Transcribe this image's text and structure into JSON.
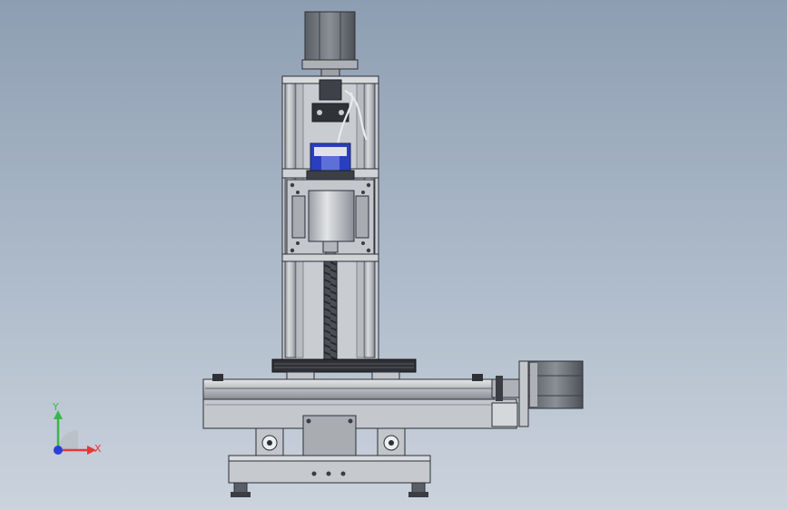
{
  "view": {
    "triad": {
      "x_label": "X",
      "y_label": "Y",
      "x_color": "#e8353a",
      "y_color": "#37b84a",
      "z_color": "#2b3fd8"
    },
    "colors": {
      "background_top": "#8e9eb2",
      "background_bottom": "#cbd3dd",
      "frame": "#c7cace",
      "frame_dark": "#5a5e66",
      "outline": "#2c2f36",
      "motor_light": "#c9ccd0",
      "motor_dark": "#6c7078",
      "motor_blue": "#2a3fbf",
      "leadscrew": "#3a3d42",
      "table_top": "#2e3035"
    }
  }
}
